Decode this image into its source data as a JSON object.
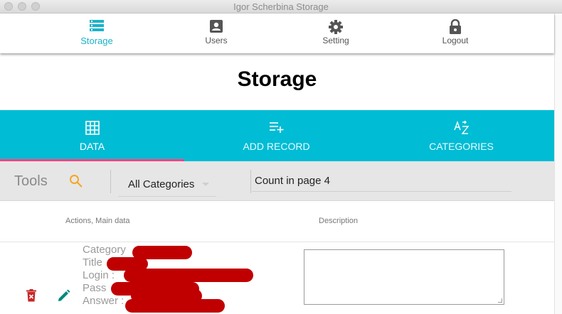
{
  "window": {
    "title": "Igor Scherbina Storage"
  },
  "nav": [
    {
      "label": "Storage",
      "icon": "storage-icon",
      "active": true
    },
    {
      "label": "Users",
      "icon": "user-card-icon"
    },
    {
      "label": "Setting",
      "icon": "gear-icon"
    },
    {
      "label": "Logout",
      "icon": "lock-icon"
    }
  ],
  "page": {
    "title": "Storage"
  },
  "tabs": [
    {
      "label": "DATA",
      "icon": "grid-icon",
      "active": true
    },
    {
      "label": "ADD RECORD",
      "icon": "playlist-add-icon"
    },
    {
      "label": "CATEGORIES",
      "icon": "sort-az-icon"
    }
  ],
  "tools": {
    "label": "Tools",
    "category_value": "All Categories",
    "count_value": "Count in page 4"
  },
  "table": {
    "headers": [
      "Actions, Main data",
      "Description"
    ],
    "fields": [
      "Category",
      "Title",
      "Login :",
      "Pass",
      "Answer :"
    ]
  },
  "colors": {
    "accent": "#00bcd4",
    "indicator": "#ff4081",
    "search": "#f5a623",
    "delete": "#c62828",
    "edit": "#00897b"
  }
}
